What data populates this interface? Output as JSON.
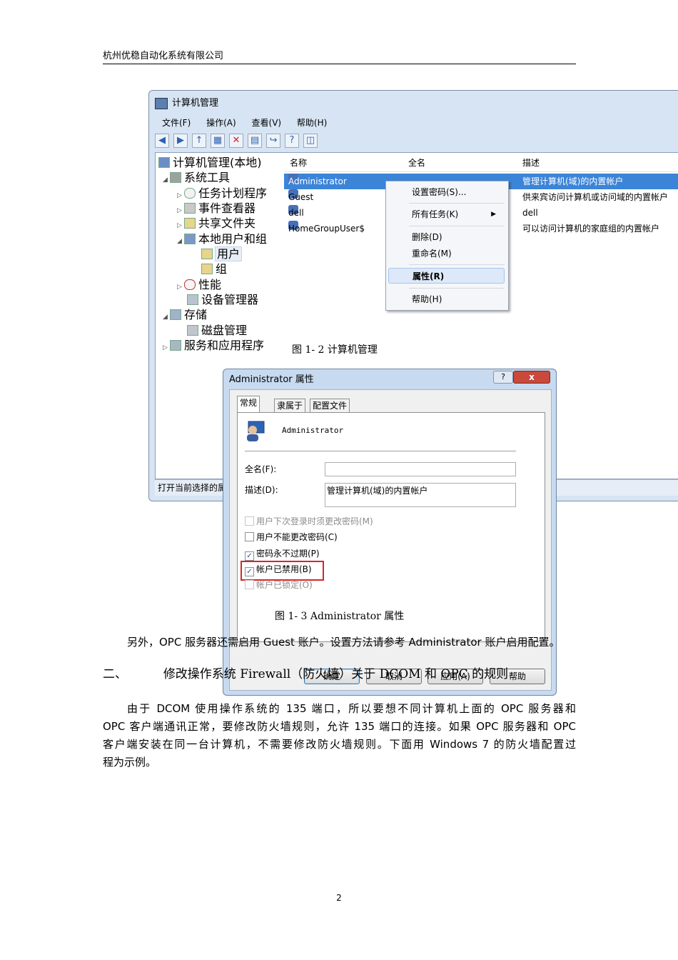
{
  "header": {
    "company": "杭州优稳自动化系统有限公司"
  },
  "cm_window": {
    "title": "计算机管理",
    "menu": [
      "文件(F)",
      "操作(A)",
      "查看(V)",
      "帮助(H)"
    ],
    "tree": {
      "root": "计算机管理(本地)",
      "system_tools": "系统工具",
      "task_scheduler": "任务计划程序",
      "event_viewer": "事件查看器",
      "shared_folders": "共享文件夹",
      "local_users_groups": "本地用户和组",
      "users": "用户",
      "groups": "组",
      "performance": "性能",
      "device_manager": "设备管理器",
      "storage": "存储",
      "disk_management": "磁盘管理",
      "services_apps": "服务和应用程序"
    },
    "columns": {
      "name": "名称",
      "fullname": "全名",
      "description": "描述"
    },
    "rows": [
      {
        "name": "Administrator",
        "description": "管理计算机(域)的内置帐户"
      },
      {
        "name": "Guest",
        "description": "供来宾访问计算机或访问域的内置帐户"
      },
      {
        "name": "dell",
        "description": "dell"
      },
      {
        "name": "HomeGroupUser$",
        "description": "可以访问计算机的家庭组的内置帐户"
      }
    ],
    "status": "打开当前选择的属"
  },
  "context_menu": {
    "set_password": "设置密码(S)...",
    "all_tasks": "所有任务(K)",
    "delete": "删除(D)",
    "rename": "重命名(M)",
    "properties": "属性(R)",
    "help": "帮助(H)"
  },
  "caption1": "图 1- 2  计算机管理",
  "dialog": {
    "title": "Administrator 属性",
    "help_btn": "?",
    "close_btn": "x",
    "tabs": [
      "常规",
      "隶属于",
      "配置文件"
    ],
    "username": "Administrator",
    "fullname_label": "全名(F):",
    "fullname_value": "",
    "desc_label": "描述(D):",
    "desc_value": "管理计算机(域)的内置帐户",
    "options": [
      {
        "label": "用户下次登录时须更改密码(M)",
        "checked": false,
        "disabled": true
      },
      {
        "label": "用户不能更改密码(C)",
        "checked": false,
        "disabled": false
      },
      {
        "label": "密码永不过期(P)",
        "checked": true,
        "disabled": false
      },
      {
        "label": "帐户已禁用(B)",
        "checked": true,
        "disabled": false
      },
      {
        "label": "帐户已锁定(O)",
        "checked": false,
        "disabled": true
      }
    ],
    "caption": "图 1- 3 Administrator 属性",
    "buttons": {
      "ok": "确定",
      "cancel": "取消",
      "apply": "应用(A)",
      "help": "帮助"
    }
  },
  "paragraph1": "另外，OPC 服务器还需启用 Guest 账户。设置方法请参考 Administrator 账户启用配置。",
  "heading": {
    "number": "二、",
    "text": "修改操作系统 Firewall（防火墙）关于 DCOM 和 OPC 的规则"
  },
  "paragraph2": {
    "line1": "由于 DCOM 使用操作系统的 135 端口，所以要想不同计算机上面的 OPC 服务器和",
    "line2": "OPC 客户端通讯正常，要修改防火墙规则，允许 135 端口的连接。如果 OPC 服务器和 OPC",
    "line3": "客户端安装在同一台计算机，不需要修改防火墙规则。下面用 Windows 7 的防火墙配置过",
    "line4": "程为示例。"
  },
  "page_number": "2"
}
